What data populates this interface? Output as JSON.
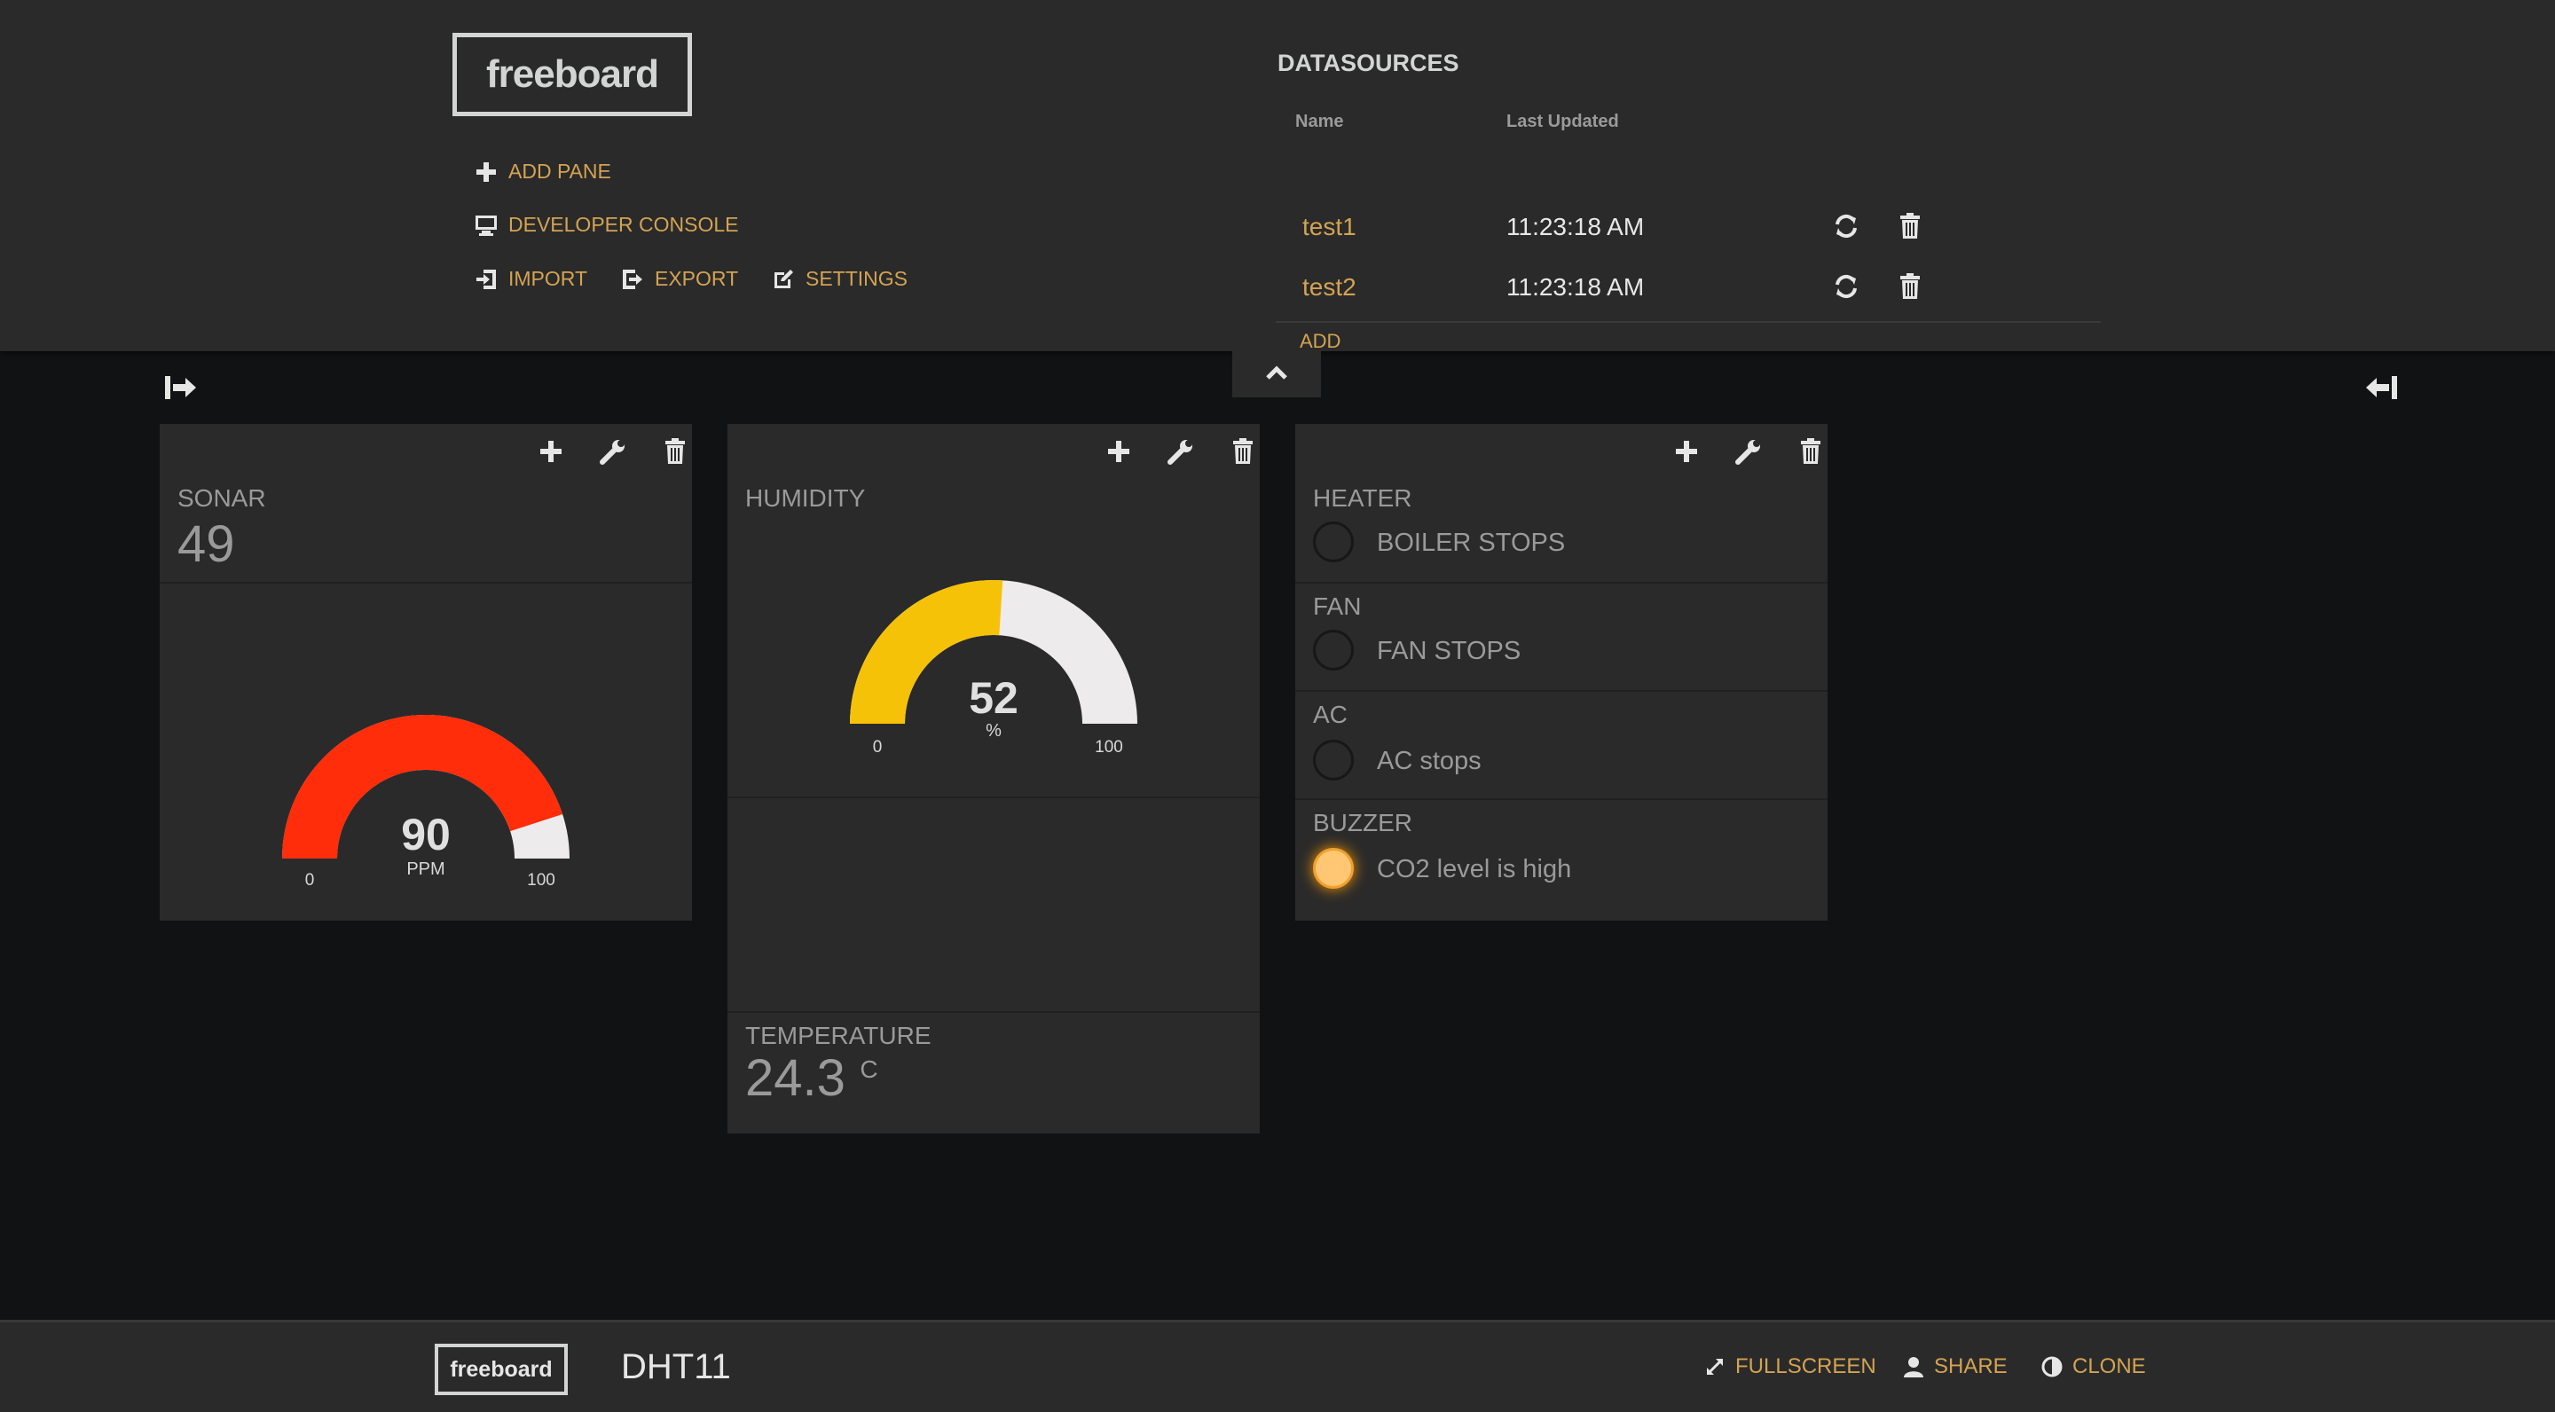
{
  "header": {
    "logo": "freeboard",
    "menu": {
      "add_pane": "ADD PANE",
      "developer_console": "DEVELOPER CONSOLE",
      "import": "IMPORT",
      "export": "EXPORT",
      "settings": "SETTINGS"
    },
    "datasources": {
      "title": "DATASOURCES",
      "col_name": "Name",
      "col_updated": "Last Updated",
      "rows": [
        {
          "name": "test1",
          "updated": "11:23:18 AM"
        },
        {
          "name": "test2",
          "updated": "11:23:18 AM"
        }
      ],
      "add_label": "ADD"
    }
  },
  "panes": {
    "pane1": {
      "sonar": {
        "title": "SONAR",
        "value": "49"
      },
      "gauge": {
        "value": "90",
        "units": "PPM",
        "min": "0",
        "max": "100",
        "fraction": 0.9,
        "fill_color": "#ff2d0a"
      }
    },
    "pane2": {
      "humidity": {
        "title": "HUMIDITY"
      },
      "gauge": {
        "value": "52",
        "units": "%",
        "min": "0",
        "max": "100",
        "fraction": 0.52,
        "fill_color": "#f6c208"
      },
      "temperature": {
        "title": "TEMPERATURE",
        "value": "24.3",
        "units": "C"
      }
    },
    "pane3": {
      "indicators": [
        {
          "title": "HEATER",
          "text": "BOILER STOPS",
          "on": false
        },
        {
          "title": "FAN",
          "text": "FAN STOPS",
          "on": false
        },
        {
          "title": "AC",
          "text": "AC stops",
          "on": false
        },
        {
          "title": "BUZZER",
          "text": "CO2 level is high",
          "on": true
        }
      ]
    }
  },
  "footer": {
    "logo": "freeboard",
    "board_name": "DHT11",
    "fullscreen": "FULLSCREEN",
    "share": "SHARE",
    "clone": "CLONE"
  },
  "colors": {
    "accent": "#d3a353",
    "gauge_empty": "#edebeb",
    "panel": "#2a2a2a",
    "background": "#101214"
  }
}
